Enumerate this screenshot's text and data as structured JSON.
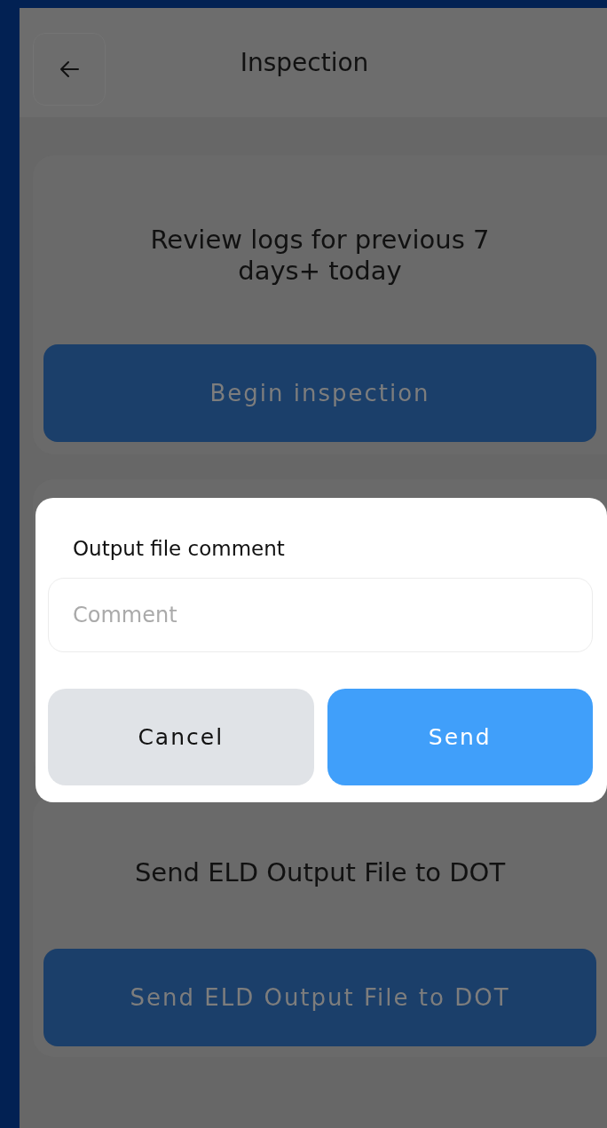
{
  "header": {
    "title": "Inspection"
  },
  "cards": [
    {
      "text": "Review logs for previous 7 days+ today",
      "button": "Begin inspection"
    },
    {
      "text": "Send ELD Output File to DOT",
      "button": "Send ELD Output File to DOT"
    }
  ],
  "dialog": {
    "title": "Output file comment",
    "comment_field": {
      "placeholder": "Comment"
    },
    "buttons": [
      {
        "label": "Cancel",
        "kind": "secondary"
      },
      {
        "label": "Send",
        "kind": "primary"
      }
    ]
  }
}
